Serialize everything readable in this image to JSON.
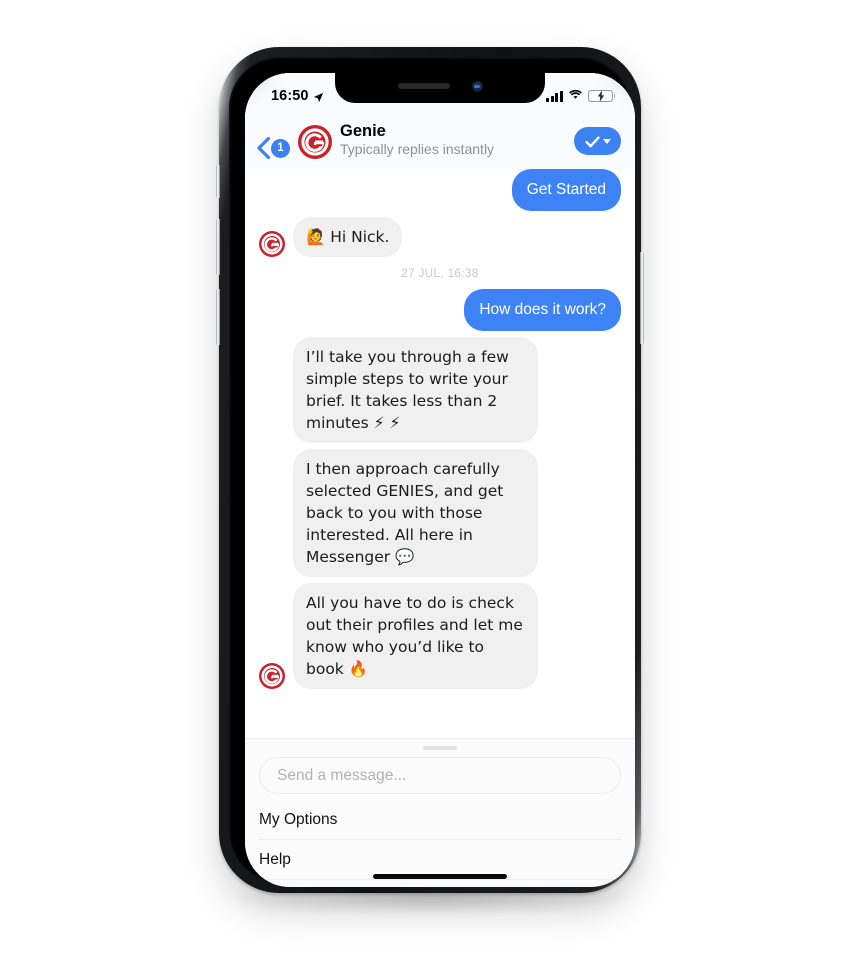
{
  "status_bar": {
    "time": "16:50",
    "location_icon": "location-arrow-icon",
    "signal_icon": "cellular-signal-icon",
    "wifi_icon": "wifi-icon",
    "battery_icon": "battery-charging-icon",
    "battery_level_percent": 48
  },
  "header": {
    "back_icon": "chevron-left-icon",
    "unread_badge": "1",
    "avatar_icon": "genie-logo-icon",
    "title": "Genie",
    "subtitle": "Typically replies instantly",
    "action_icon": "check-icon",
    "action_caret_icon": "chevron-down-icon",
    "accent_color": "#3b82f3"
  },
  "thread": {
    "daystamp": "27 JUL, 16:38",
    "messages": [
      {
        "id": "m0",
        "side": "out",
        "text": "Get Started",
        "avatar": false
      },
      {
        "id": "m1",
        "side": "in",
        "text": "🙋 Hi Nick.",
        "avatar": true
      },
      {
        "id": "m2",
        "side": "out",
        "text": "How does it work?",
        "avatar": false
      },
      {
        "id": "m3",
        "side": "in",
        "text": "I’ll take you through a few simple steps to write your brief. It takes less than 2 minutes ⚡ ⚡",
        "avatar": false
      },
      {
        "id": "m4",
        "side": "in",
        "text": "I then approach carefully selected GENIES, and get back to you with those interested. All here in Messenger 💬",
        "avatar": false
      },
      {
        "id": "m5",
        "side": "in",
        "text": "All you have to do is check out their profiles and let me know who you’d like to book 🔥",
        "avatar": true
      }
    ]
  },
  "composer": {
    "grabber_icon": "drag-handle-icon",
    "input_placeholder": "Send a message...",
    "input_value": "",
    "menu_items": [
      {
        "label": "My Options"
      },
      {
        "label": "Help"
      }
    ]
  },
  "colors": {
    "outgoing_bubble": "#3d83f5",
    "incoming_bubble": "#f0f0f0",
    "brand_red": "#c8232a",
    "header_bg": "#fafbfd"
  }
}
